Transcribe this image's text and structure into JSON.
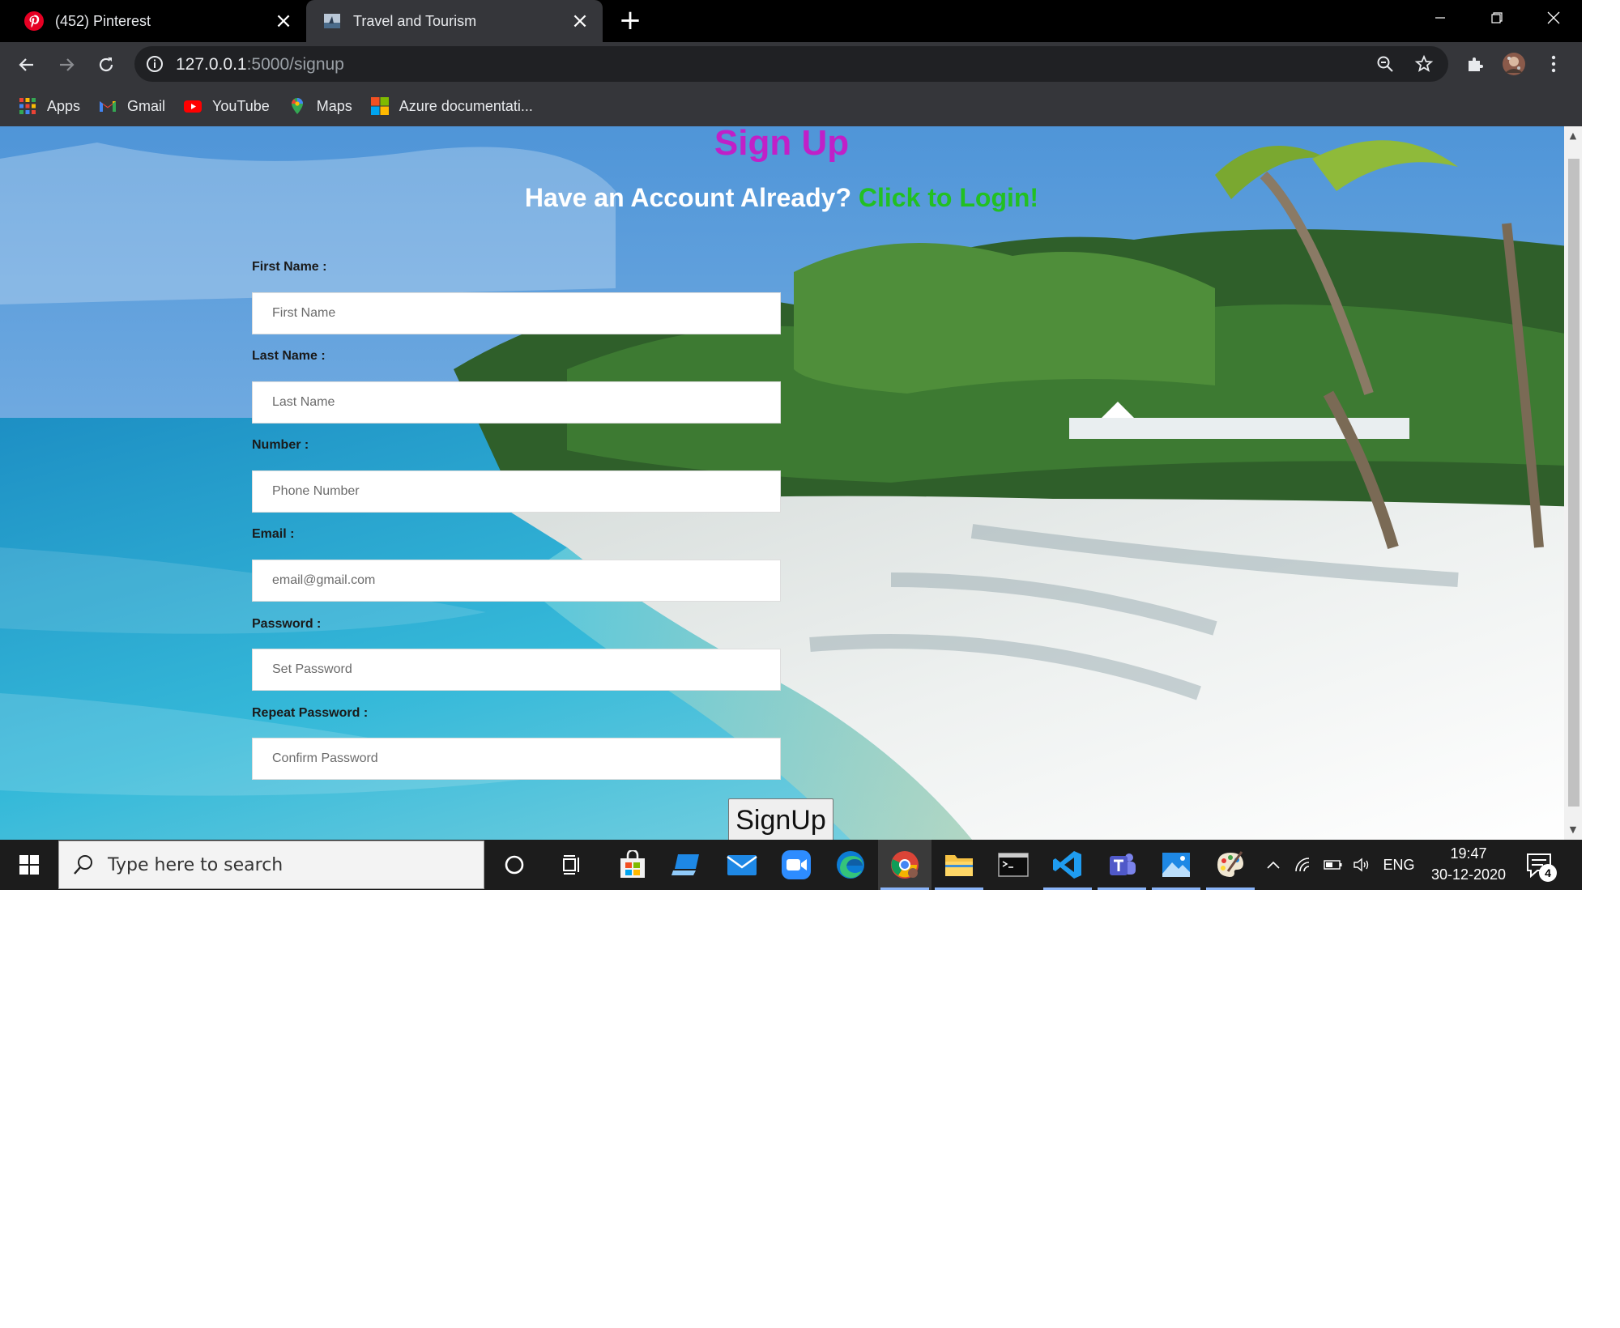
{
  "browser": {
    "tabs": [
      {
        "title": "(452) Pinterest",
        "active": false,
        "favicon": "pinterest-icon"
      },
      {
        "title": "Travel and Tourism",
        "active": true,
        "favicon": "site-icon"
      }
    ],
    "url": {
      "host": "127.0.0.1",
      "path": ":5000/signup"
    },
    "bookmarks": [
      {
        "label": "Apps",
        "icon": "apps-grid-icon"
      },
      {
        "label": "Gmail",
        "icon": "gmail-icon"
      },
      {
        "label": "YouTube",
        "icon": "youtube-icon"
      },
      {
        "label": "Maps",
        "icon": "maps-icon"
      },
      {
        "label": "Azure documentati...",
        "icon": "microsoft-icon"
      }
    ]
  },
  "page": {
    "title": "Sign Up",
    "login_prompt": "Have an Account Already? ",
    "login_link": "Click to Login!",
    "fields": [
      {
        "label": "First Name",
        "suffix": " :",
        "placeholder": "First Name"
      },
      {
        "label": "Last Name",
        "suffix": " :",
        "placeholder": "Last Name"
      },
      {
        "label": "Number",
        "suffix": " :",
        "placeholder": "Phone Number"
      },
      {
        "label": "Email",
        "suffix": " :",
        "placeholder": "email@gmail.com"
      },
      {
        "label": "Password",
        "suffix": " :",
        "placeholder": "Set Password"
      },
      {
        "label": "Repeat Password",
        "suffix": " :",
        "placeholder": "Confirm Password"
      }
    ],
    "submit_label": "SignUp"
  },
  "taskbar": {
    "search_placeholder": "Type here to search",
    "language": "ENG",
    "time": "19:47",
    "date": "30-12-2020",
    "notification_count": "4"
  },
  "colors": {
    "title": "#c020c8",
    "login_link": "#22c022",
    "browser_dark": "#35363a"
  }
}
